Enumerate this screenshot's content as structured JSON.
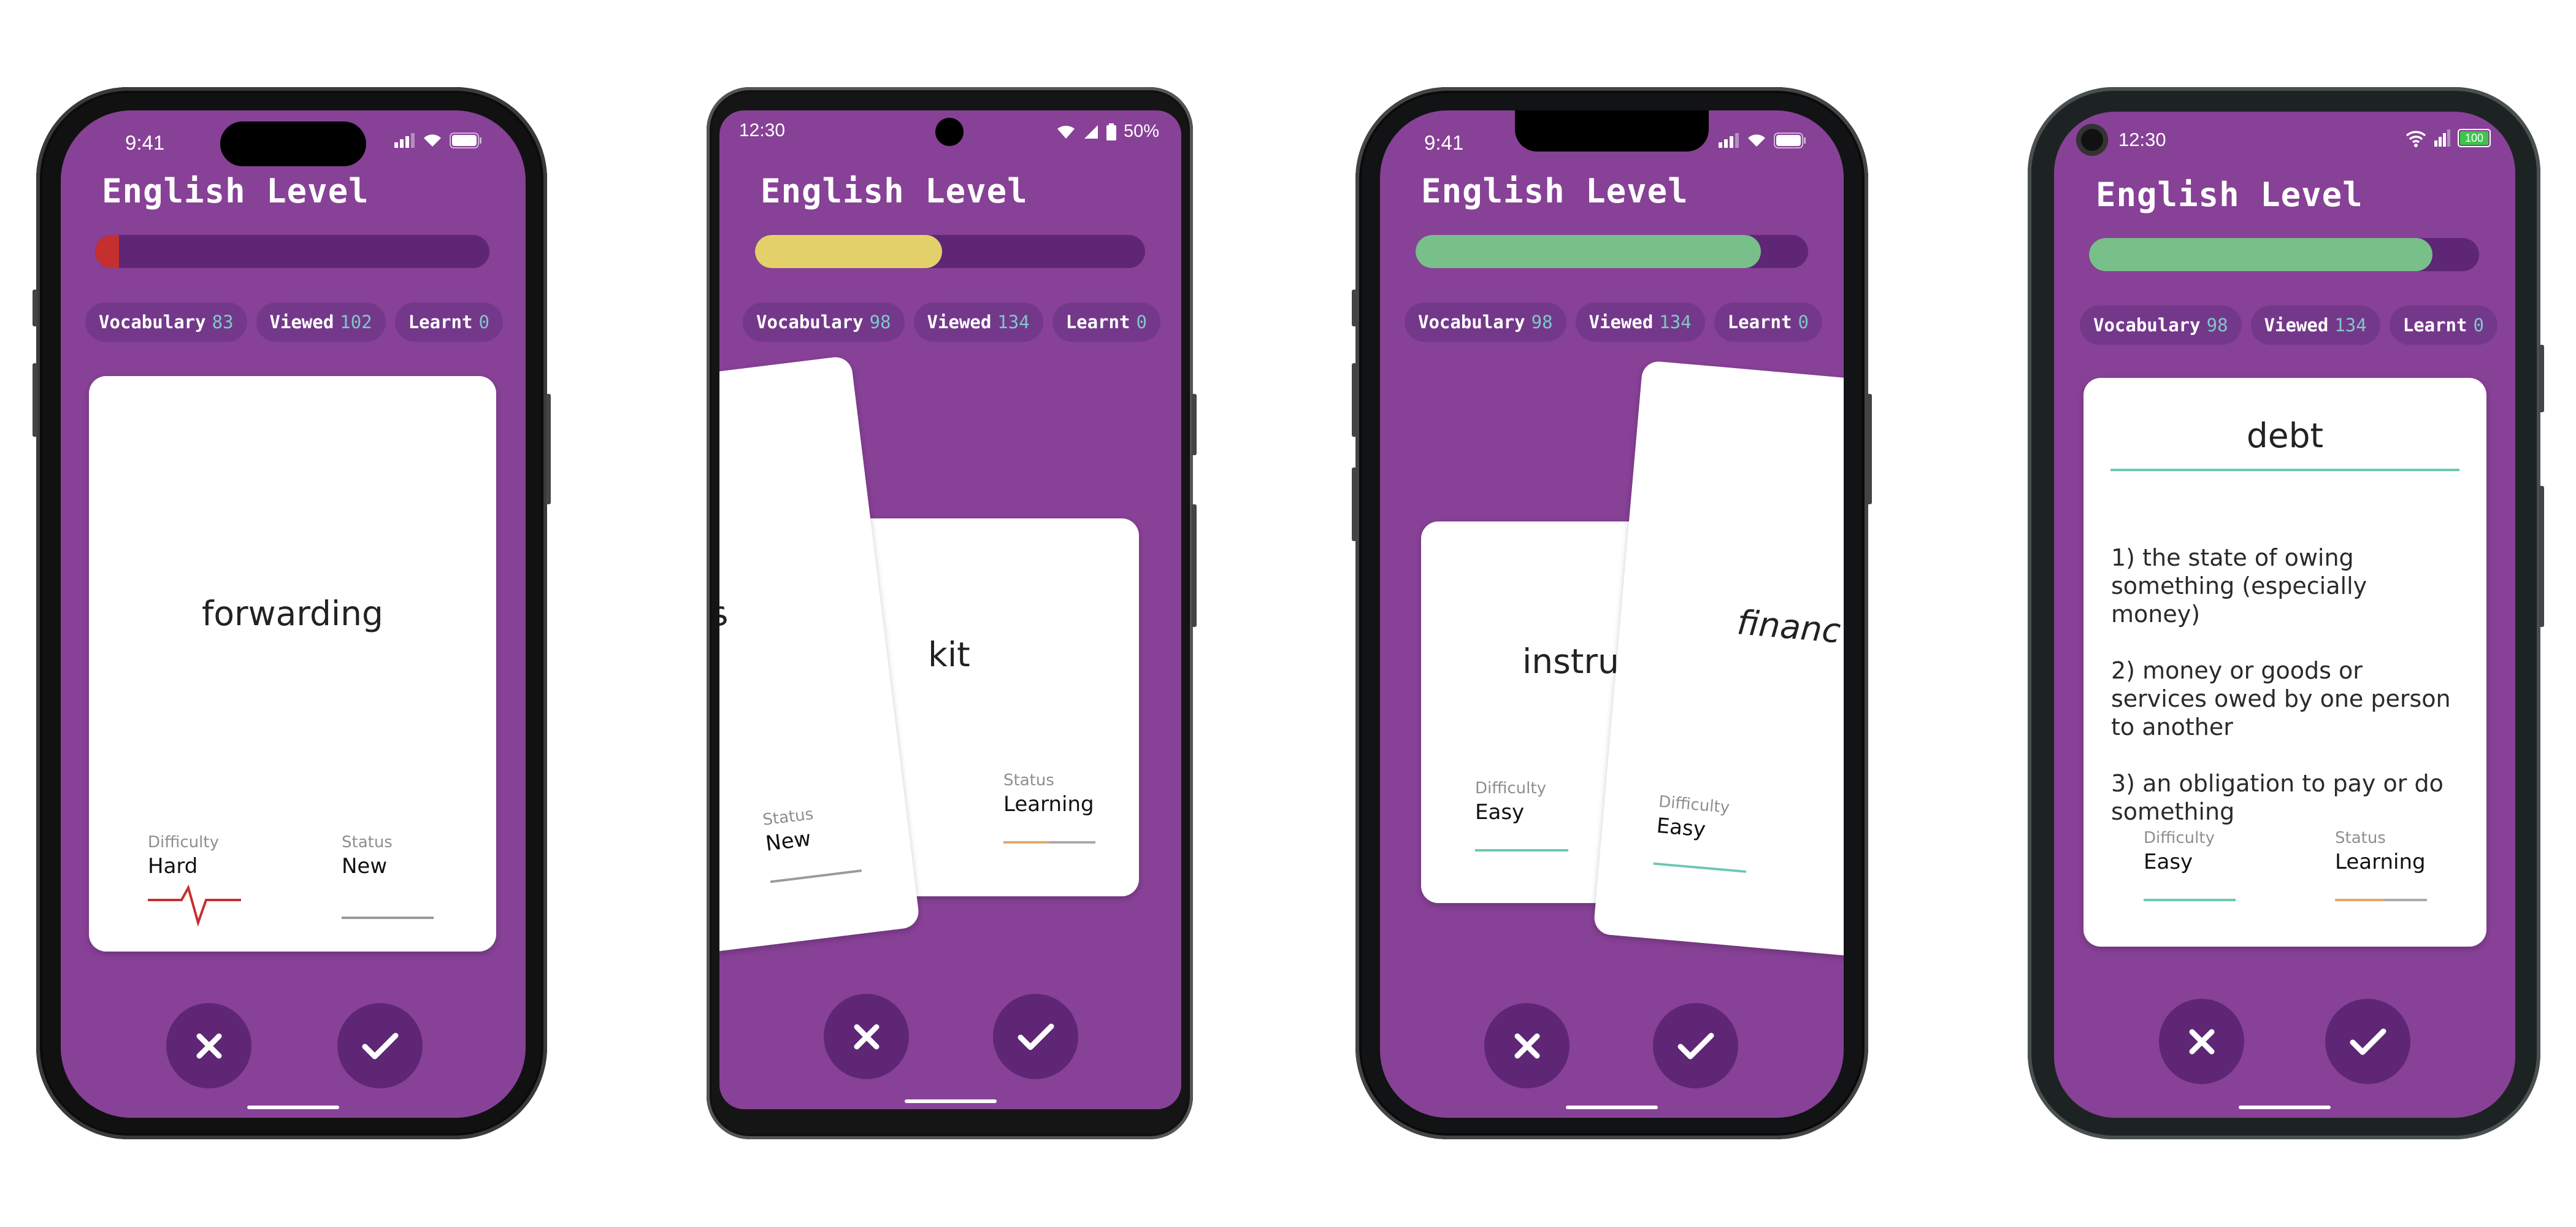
{
  "colors": {
    "background": "#874196",
    "dark": "#5e2675",
    "chip": "#74388a",
    "count": "#7fc8c8",
    "hard": "#c62f2f",
    "easy": "#6cc7b3",
    "learning": "#e2a96a",
    "new": "#9a9a9a"
  },
  "app": {
    "title": "English Level",
    "difficulty_label": "Difficulty",
    "status_label": "Status",
    "reject_icon": "x-icon",
    "accept_icon": "check-icon"
  },
  "phones": [
    {
      "status_time": "9:41",
      "progress_percent": 6,
      "progress_color": "#c62f2f",
      "stats": [
        {
          "label": "Vocabulary",
          "value": "83"
        },
        {
          "label": "Viewed",
          "value": "102"
        },
        {
          "label": "Learnt",
          "value": "0"
        }
      ],
      "card": {
        "word": "forwarding",
        "difficulty": "Hard",
        "status": "New"
      }
    },
    {
      "status_time": "12:30",
      "battery_text": "50%",
      "progress_percent": 48,
      "progress_color": "#e3d06a",
      "stats": [
        {
          "label": "Vocabulary",
          "value": "98"
        },
        {
          "label": "Viewed",
          "value": "134"
        },
        {
          "label": "Learnt",
          "value": "0"
        }
      ],
      "front_card": {
        "word": "ons",
        "status": "New"
      },
      "back_card": {
        "word": "kit",
        "status": "Learning"
      }
    },
    {
      "status_time": "9:41",
      "progress_percent": 88,
      "progress_color": "#78bf8a",
      "stats": [
        {
          "label": "Vocabulary",
          "value": "98"
        },
        {
          "label": "Viewed",
          "value": "134"
        },
        {
          "label": "Learnt",
          "value": "0"
        }
      ],
      "back_card": {
        "word": "instruc",
        "difficulty": "Easy"
      },
      "front_card": {
        "word": "financ",
        "difficulty": "Easy"
      }
    },
    {
      "status_time": "12:30",
      "battery_text": "100",
      "progress_percent": 88,
      "progress_color": "#78bf8a",
      "stats": [
        {
          "label": "Vocabulary",
          "value": "98"
        },
        {
          "label": "Viewed",
          "value": "134"
        },
        {
          "label": "Learnt",
          "value": "0"
        }
      ],
      "card": {
        "word": "debt",
        "definitions": [
          "1) the state of owing something (especially money)",
          "2) money or goods or services owed by one person to another",
          "3) an obligation to pay or do something"
        ],
        "difficulty": "Easy",
        "status": "Learning"
      }
    }
  ]
}
